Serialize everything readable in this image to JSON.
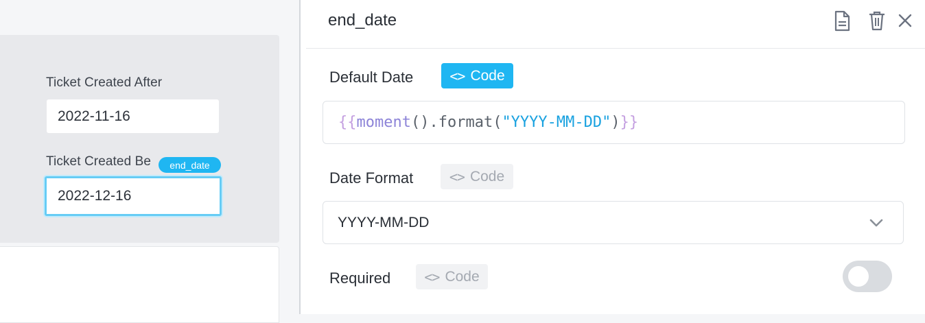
{
  "canvas": {
    "fields": [
      {
        "label": "Ticket Created After",
        "value": "2022-11-16"
      },
      {
        "label": "Ticket Created Be",
        "value": "2022-12-16"
      }
    ],
    "selected_tag": "end_date"
  },
  "inspector": {
    "title": "end_date",
    "icons": [
      "document-icon",
      "trash-icon",
      "close-icon"
    ],
    "default_date": {
      "label": "Default Date",
      "code_button": "Code",
      "code_active": true,
      "code_tokens": [
        "{{",
        "moment",
        "().format(",
        "\"YYYY-MM-DD\"",
        ")",
        "}}"
      ]
    },
    "date_format": {
      "label": "Date Format",
      "code_button": "Code",
      "code_active": false,
      "selected": "YYYY-MM-DD"
    },
    "required": {
      "label": "Required",
      "code_button": "Code",
      "code_active": false,
      "toggle_on": false
    }
  },
  "colors": {
    "accent": "#1fb6f2",
    "selection_border": "#66ccf5",
    "panel_bg": "#e8e9ec"
  }
}
